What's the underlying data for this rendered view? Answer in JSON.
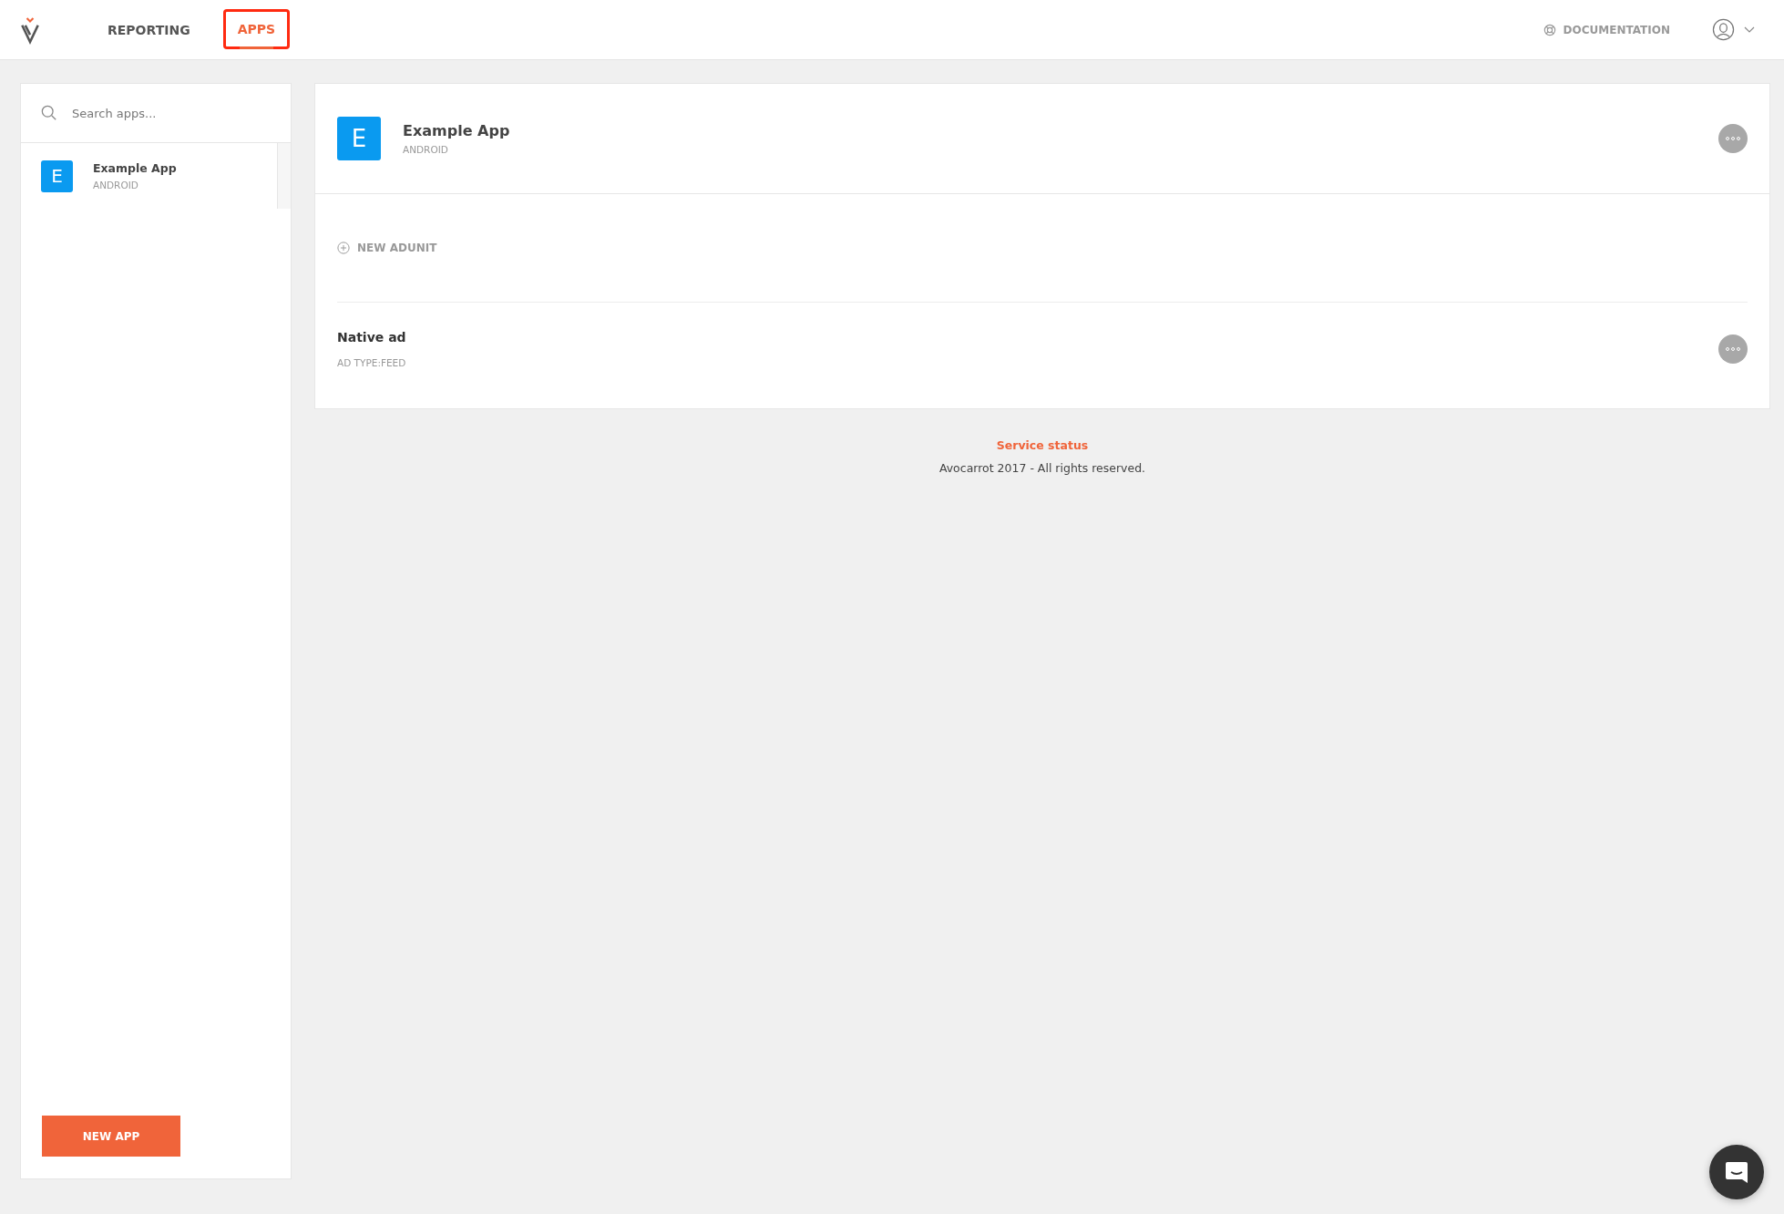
{
  "nav": {
    "tabs": [
      {
        "label": "REPORTING",
        "selected": false,
        "highlighted": false
      },
      {
        "label": "APPS",
        "selected": true,
        "highlighted": true
      }
    ],
    "documentation": "DOCUMENTATION"
  },
  "sidebar": {
    "search": {
      "placeholder": "Search apps..."
    },
    "apps": [
      {
        "letter": "E",
        "name": "Example App",
        "platform": "ANDROID"
      }
    ],
    "new_app_button": "NEW APP"
  },
  "app_card": {
    "letter": "E",
    "name": "Example App",
    "platform": "ANDROID",
    "new_adunit": "NEW ADUNIT",
    "ad_units": [
      {
        "name": "Native ad",
        "type": "AD TYPE:FEED"
      }
    ]
  },
  "footer": {
    "service_status": "Service status",
    "copyright": "Avocarrot 2017 - All rights reserved."
  }
}
